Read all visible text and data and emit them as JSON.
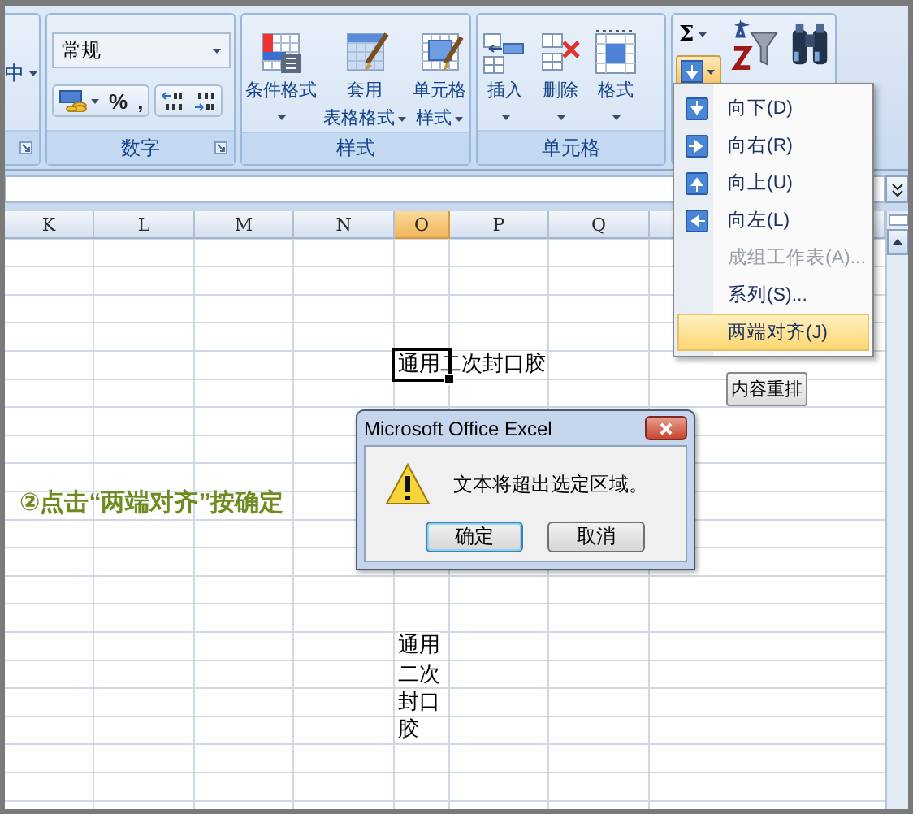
{
  "ribbon": {
    "groups": [
      {
        "kind": "partial",
        "label_fragment": "中"
      },
      {
        "kind": "number",
        "label": "数字",
        "format": "常规",
        "symbols": [
          "%",
          ","
        ]
      },
      {
        "kind": "styles",
        "label": "样式",
        "buttons": [
          {
            "kind": "conditional",
            "lines": [
              "条件格式"
            ]
          },
          {
            "kind": "table",
            "lines": [
              "套用",
              "表格格式"
            ]
          },
          {
            "kind": "cellstyle",
            "lines": [
              "单元格",
              "样式"
            ]
          }
        ]
      },
      {
        "kind": "cells",
        "label": "单元格",
        "buttons": [
          {
            "kind": "insert",
            "label": "插入"
          },
          {
            "kind": "delete",
            "label": "删除"
          },
          {
            "kind": "format",
            "label": "格式"
          }
        ]
      },
      {
        "kind": "editing",
        "sum": "Σ",
        "fill_open": true
      }
    ]
  },
  "fill_menu": {
    "items": [
      {
        "kind": "down",
        "label": "向下(D)",
        "disabled": false,
        "selected": false
      },
      {
        "kind": "right",
        "label": "向右(R)",
        "disabled": false,
        "selected": false
      },
      {
        "kind": "up",
        "label": "向上(U)",
        "disabled": false,
        "selected": false
      },
      {
        "kind": "left",
        "label": "向左(L)",
        "disabled": false,
        "selected": false
      },
      {
        "kind": "plain",
        "label": "成组工作表(A)...",
        "disabled": true,
        "selected": false
      },
      {
        "kind": "plain",
        "label": "系列(S)...",
        "disabled": false,
        "selected": false
      },
      {
        "kind": "plain",
        "label": "两端对齐(J)",
        "disabled": false,
        "selected": true
      }
    ]
  },
  "sheet": {
    "columns": [
      {
        "label": "K",
        "selected": false
      },
      {
        "label": "L",
        "selected": false
      },
      {
        "label": "M",
        "selected": false
      },
      {
        "label": "N",
        "selected": false
      },
      {
        "label": "O",
        "selected": true
      },
      {
        "label": "P",
        "selected": false
      },
      {
        "label": "Q",
        "selected": false
      }
    ],
    "active_cell": "通用二次封口胶",
    "wrapped_lines": [
      "通用",
      "二次",
      "封口",
      "胶"
    ],
    "reflow_button": "内容重排"
  },
  "annotation": "②点击“两端对齐”按确定",
  "dialog": {
    "title": "Microsoft Office Excel",
    "message": "文本将超出选定区域。",
    "buttons": [
      {
        "label": "确定",
        "default": true
      },
      {
        "label": "取消",
        "default": false
      }
    ]
  }
}
